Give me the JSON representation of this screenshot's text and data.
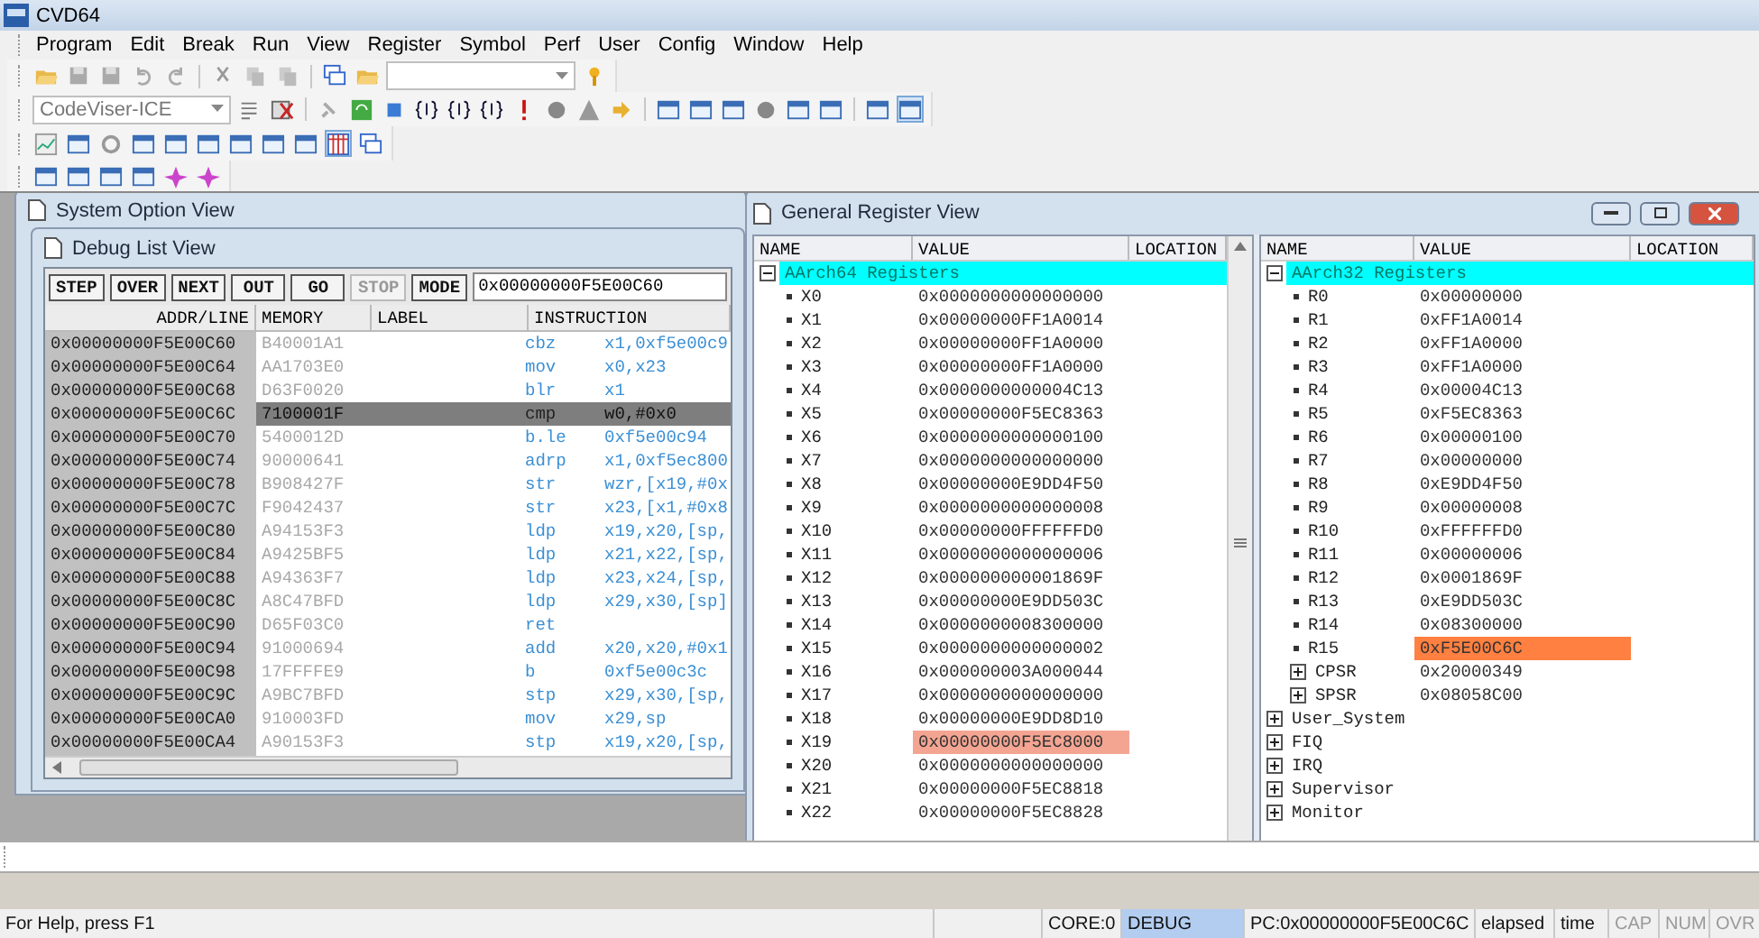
{
  "window": {
    "title": "CVD64"
  },
  "menu": [
    "Program",
    "Edit",
    "Break",
    "Run",
    "View",
    "Register",
    "Symbol",
    "Perf",
    "User",
    "Config",
    "Window",
    "Help"
  ],
  "toolbar": {
    "target": "CodeViser-ICE"
  },
  "background_window": {
    "title": "System Option View"
  },
  "debug_list": {
    "title": "Debug List View",
    "buttons": [
      {
        "label": "STEP",
        "disabled": false
      },
      {
        "label": "OVER",
        "disabled": false
      },
      {
        "label": "NEXT",
        "disabled": false
      },
      {
        "label": "OUT",
        "disabled": false
      },
      {
        "label": "GO",
        "disabled": false
      },
      {
        "label": "STOP",
        "disabled": true
      },
      {
        "label": "MODE",
        "disabled": false
      }
    ],
    "address": "0x00000000F5E00C60",
    "columns": [
      "ADDR/LINE",
      "MEMORY",
      "LABEL",
      "INSTRUCTION"
    ],
    "rows": [
      {
        "addr": "0x00000000F5E00C60",
        "memory": "B40001A1",
        "mnemonic": "cbz",
        "operands": "x1,0xf5e00c9",
        "selected": false
      },
      {
        "addr": "0x00000000F5E00C64",
        "memory": "AA1703E0",
        "mnemonic": "mov",
        "operands": "x0,x23",
        "selected": false
      },
      {
        "addr": "0x00000000F5E00C68",
        "memory": "D63F0020",
        "mnemonic": "blr",
        "operands": "x1",
        "selected": false
      },
      {
        "addr": "0x00000000F5E00C6C",
        "memory": "7100001F",
        "mnemonic": "cmp",
        "operands": "w0,#0x0",
        "selected": true
      },
      {
        "addr": "0x00000000F5E00C70",
        "memory": "5400012D",
        "mnemonic": "b.le",
        "operands": "0xf5e00c94",
        "selected": false
      },
      {
        "addr": "0x00000000F5E00C74",
        "memory": "90000641",
        "mnemonic": "adrp",
        "operands": "x1,0xf5ec800",
        "selected": false
      },
      {
        "addr": "0x00000000F5E00C78",
        "memory": "B908427F",
        "mnemonic": "str",
        "operands": "wzr,[x19,#0x",
        "selected": false
      },
      {
        "addr": "0x00000000F5E00C7C",
        "memory": "F9042437",
        "mnemonic": "str",
        "operands": "x23,[x1,#0x8",
        "selected": false
      },
      {
        "addr": "0x00000000F5E00C80",
        "memory": "A94153F3",
        "mnemonic": "ldp",
        "operands": "x19,x20,[sp,",
        "selected": false
      },
      {
        "addr": "0x00000000F5E00C84",
        "memory": "A9425BF5",
        "mnemonic": "ldp",
        "operands": "x21,x22,[sp,",
        "selected": false
      },
      {
        "addr": "0x00000000F5E00C88",
        "memory": "A94363F7",
        "mnemonic": "ldp",
        "operands": "x23,x24,[sp,",
        "selected": false
      },
      {
        "addr": "0x00000000F5E00C8C",
        "memory": "A8C47BFD",
        "mnemonic": "ldp",
        "operands": "x29,x30,[sp]",
        "selected": false
      },
      {
        "addr": "0x00000000F5E00C90",
        "memory": "D65F03C0",
        "mnemonic": "ret",
        "selected": false
      },
      {
        "addr": "0x00000000F5E00C94",
        "memory": "91000694",
        "mnemonic": "add",
        "operands": "x20,x20,#0x1",
        "selected": false
      },
      {
        "addr": "0x00000000F5E00C98",
        "memory": "17FFFFE9",
        "mnemonic": "b",
        "operands": "0xf5e00c3c",
        "selected": false
      },
      {
        "addr": "0x00000000F5E00C9C",
        "memory": "A9BC7BFD",
        "mnemonic": "stp",
        "operands": "x29,x30,[sp,",
        "selected": false
      },
      {
        "addr": "0x00000000F5E00CA0",
        "memory": "910003FD",
        "mnemonic": "mov",
        "operands": "x29,sp",
        "selected": false
      },
      {
        "addr": "0x00000000F5E00CA4",
        "memory": "A90153F3",
        "mnemonic": "stp",
        "operands": "x19,x20,[sp,",
        "selected": false
      }
    ]
  },
  "register_view": {
    "title": "General Register View",
    "panels": [
      {
        "columns": [
          "NAME",
          "VALUE",
          "LOCATION"
        ],
        "group": {
          "label": "AArch64 Registers",
          "expanded": true
        },
        "registers": [
          {
            "name": "X0",
            "value": "0x0000000000000000"
          },
          {
            "name": "X1",
            "value": "0x00000000FF1A0014"
          },
          {
            "name": "X2",
            "value": "0x00000000FF1A0000"
          },
          {
            "name": "X3",
            "value": "0x00000000FF1A0000"
          },
          {
            "name": "X4",
            "value": "0x0000000000004C13"
          },
          {
            "name": "X5",
            "value": "0x00000000F5EC8363"
          },
          {
            "name": "X6",
            "value": "0x0000000000000100"
          },
          {
            "name": "X7",
            "value": "0x0000000000000000"
          },
          {
            "name": "X8",
            "value": "0x00000000E9DD4F50"
          },
          {
            "name": "X9",
            "value": "0x0000000000000008"
          },
          {
            "name": "X10",
            "value": "0x00000000FFFFFFD0"
          },
          {
            "name": "X11",
            "value": "0x0000000000000006"
          },
          {
            "name": "X12",
            "value": "0x000000000001869F"
          },
          {
            "name": "X13",
            "value": "0x00000000E9DD503C"
          },
          {
            "name": "X14",
            "value": "0x0000000008300000"
          },
          {
            "name": "X15",
            "value": "0x0000000000000002"
          },
          {
            "name": "X16",
            "value": "0x000000003A000044"
          },
          {
            "name": "X17",
            "value": "0x0000000000000000"
          },
          {
            "name": "X18",
            "value": "0x00000000E9DD8D10"
          },
          {
            "name": "X19",
            "value": "0x00000000F5EC8000",
            "color": "#f4a592"
          },
          {
            "name": "X20",
            "value": "0x0000000000000000"
          },
          {
            "name": "X21",
            "value": "0x00000000F5EC8818"
          },
          {
            "name": "X22",
            "value": "0x00000000F5EC8828"
          }
        ]
      },
      {
        "columns": [
          "NAME",
          "VALUE",
          "LOCATION"
        ],
        "group": {
          "label": "AArch32 Registers",
          "expanded": true
        },
        "registers": [
          {
            "name": "R0",
            "value": "0x00000000"
          },
          {
            "name": "R1",
            "value": "0xFF1A0014"
          },
          {
            "name": "R2",
            "value": "0xFF1A0000"
          },
          {
            "name": "R3",
            "value": "0xFF1A0000"
          },
          {
            "name": "R4",
            "value": "0x00004C13"
          },
          {
            "name": "R5",
            "value": "0xF5EC8363"
          },
          {
            "name": "R6",
            "value": "0x00000100"
          },
          {
            "name": "R7",
            "value": "0x00000000"
          },
          {
            "name": "R8",
            "value": "0xE9DD4F50"
          },
          {
            "name": "R9",
            "value": "0x00000008"
          },
          {
            "name": "R10",
            "value": "0xFFFFFFD0"
          },
          {
            "name": "R11",
            "value": "0x00000006"
          },
          {
            "name": "R12",
            "value": "0x0001869F"
          },
          {
            "name": "R13",
            "value": "0xE9DD503C"
          },
          {
            "name": "R14",
            "value": "0x08300000"
          },
          {
            "name": "R15",
            "value": "0xF5E00C6C",
            "color": "#ff8040"
          }
        ],
        "flags": [
          {
            "name": "CPSR",
            "value": "0x20000349",
            "expanded": false
          },
          {
            "name": "SPSR",
            "value": "0x08058C00",
            "expanded": false
          }
        ],
        "modes": [
          {
            "label": "User_System",
            "expanded": false
          },
          {
            "label": "FIQ",
            "expanded": false
          },
          {
            "label": "IRQ",
            "expanded": false
          },
          {
            "label": "Supervisor",
            "expanded": false
          },
          {
            "label": "Monitor",
            "expanded": false
          }
        ]
      }
    ]
  },
  "status_bar": {
    "help": "For Help, press F1",
    "core": "CORE:0",
    "state": "DEBUG",
    "pc": "PC:0x00000000F5E00C6C",
    "elapsed": "elapsed",
    "time": "time",
    "indicators": [
      {
        "label": "CAP",
        "on": false
      },
      {
        "label": "NUM",
        "on": false
      },
      {
        "label": "OVR",
        "on": false
      }
    ]
  }
}
